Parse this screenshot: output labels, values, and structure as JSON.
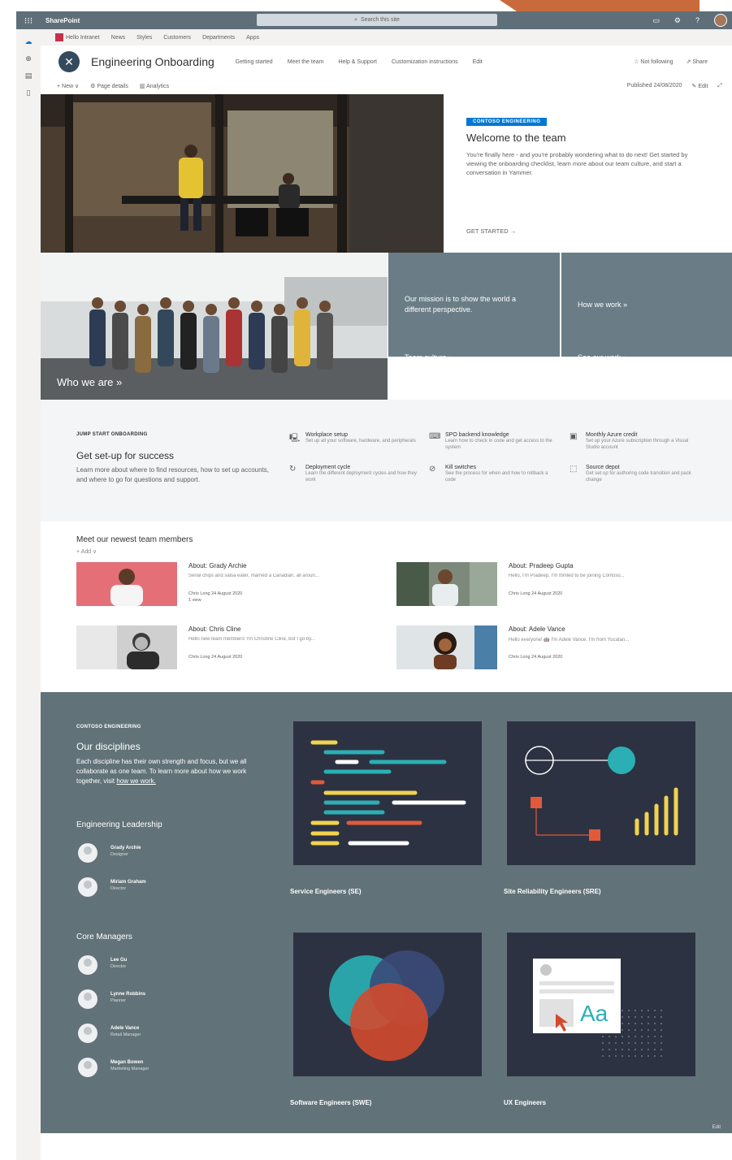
{
  "suite": {
    "app_name": "SharePoint",
    "search_placeholder": "Search this site"
  },
  "hub_nav": {
    "home": "Hello Intranet",
    "items": [
      "News",
      "Styles",
      "Customers",
      "Departments",
      "Apps"
    ]
  },
  "site": {
    "title": "Engineering Onboarding",
    "nav": [
      "Getting started",
      "Meet the team",
      "Help & Support",
      "Customization instructions",
      "Edit"
    ],
    "follow": "Not following",
    "share": "Share"
  },
  "command_bar": {
    "new": "New",
    "page_details": "Page details",
    "analytics": "Analytics",
    "published": "Published 24/08/2020",
    "edit": "Edit"
  },
  "hero": {
    "tag": "CONTOSO ENGINEERING",
    "heading": "Welcome to the team",
    "body": "You're finally here - and you're probably wondering what to do next! Get started by viewing the onboarding checklist, learn more about our team culture, and start a conversation in Yammer.",
    "cta": "GET STARTED →",
    "who": "Who we are »",
    "mission": "Our mission is to show the world a different perspective.",
    "how": "How we work »",
    "culture": "Team culture »",
    "work": "See our work »"
  },
  "jump": {
    "kicker": "JUMP START ONBOARDING",
    "heading": "Get set-up for success",
    "body": "Learn more about where to find resources, how to set up accounts, and where to go for questions and support.",
    "links": [
      {
        "title": "Workplace setup",
        "desc": "Set up all your software, hardware, and peripherals",
        "icon": "🖳"
      },
      {
        "title": "SPO backend knowledge",
        "desc": "Learn how to check in code and get access to the system",
        "icon": "⌨"
      },
      {
        "title": "Monthly Azure credit",
        "desc": "Set up your Azure subscription through a Visual Studio account",
        "icon": "▣"
      },
      {
        "title": "Deployment cycle",
        "desc": "Learn the different deployment cycles and how they work",
        "icon": "↻"
      },
      {
        "title": "Kill switches",
        "desc": "See the process for when and how to rollback a code",
        "icon": "⊘"
      },
      {
        "title": "Source depot",
        "desc": "Get set up for authoring code transition and pack change",
        "icon": "⬚"
      }
    ]
  },
  "members": {
    "heading": "Meet our newest team members",
    "add": "+ Add ∨",
    "items": [
      {
        "title": "About: Grady Archie",
        "excerpt": "Serial chips and salsa eater, married a Canadian, all aroun...",
        "author": "Chris Long  24 August 2020",
        "extra": "1 view"
      },
      {
        "title": "About: Pradeep Gupta",
        "excerpt": "Hello, I'm Pradeep. I'm thrilled to be joining Contoso...",
        "author": "Chris Long  24 August 2020",
        "extra": ""
      },
      {
        "title": "About: Chris Cline",
        "excerpt": "Hello new team members! I'm Christine Cline, but I go by...",
        "author": "Chris Long  24 August 2020",
        "extra": ""
      },
      {
        "title": "About: Adele Vance",
        "excerpt": "Hello everyone! 🤖 I'm Adele Vance. I'm from Yucatan...",
        "author": "Chris Long  24 August 2020",
        "extra": ""
      }
    ]
  },
  "disciplines": {
    "kicker": "CONTOSO ENGINEERING",
    "heading": "Our disciplines",
    "body": "Each discipline has their own strength and focus, but we all collaborate as one team. To learn more about how we work together, visit",
    "link": "how we work.",
    "leadership_heading": "Engineering Leadership",
    "leadership": [
      {
        "name": "Grady Archie",
        "role": "Designer"
      },
      {
        "name": "Miriam Graham",
        "role": "Director"
      }
    ],
    "managers_heading": "Core Managers",
    "managers": [
      {
        "name": "Lee Gu",
        "role": "Director"
      },
      {
        "name": "Lynne Robbins",
        "role": "Planner"
      },
      {
        "name": "Adele Vance",
        "role": "Retail Manager"
      },
      {
        "name": "Megan Bowen",
        "role": "Marketing Manager"
      }
    ],
    "cards": [
      "Service Engineers (SE)",
      "Site Reliability Engineers (SRE)",
      "Software Engineers (SWE)",
      "UX Engineers"
    ],
    "ux_glyph": "Aa",
    "edit": "Edit"
  }
}
